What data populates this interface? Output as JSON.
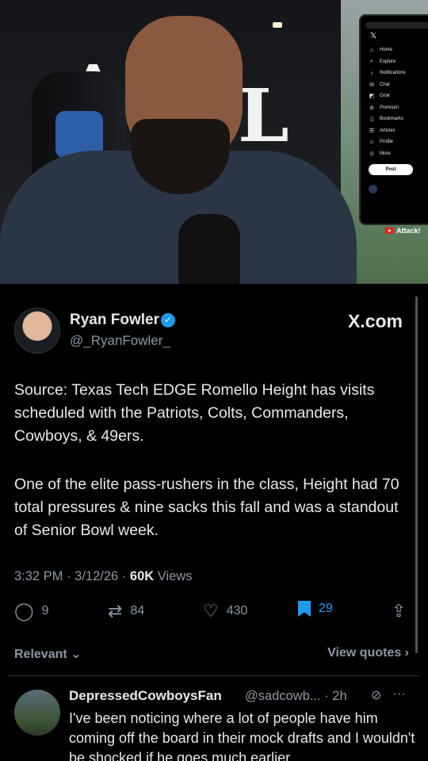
{
  "video": {
    "wall_text_1": "AL",
    "wall_text_2": "L",
    "overlay_tag": "Attack!",
    "phone_menu": [
      "Home",
      "Explore",
      "Notifications",
      "Chat",
      "Grok",
      "Premium",
      "Bookmarks",
      "Articles",
      "Profile",
      "More"
    ],
    "phone_post_label": "Post"
  },
  "tweet": {
    "author_name": "Ryan Fowler",
    "author_handle": "@_RyanFowler_",
    "source_label": "X.com",
    "paragraph_1": "Source: Texas Tech EDGE Romello Height has visits scheduled with the Patriots, Colts, Commanders, Cowboys, & 49ers.",
    "paragraph_2": "One of the elite pass-rushers in the class, Height had 70 total pressures & nine sacks this fall and was a standout of Senior Bowl week.",
    "time": "3:32 PM",
    "date": "3/12/26",
    "views_count": "60K",
    "views_label": "Views",
    "reply_count": "9",
    "retweet_count": "84",
    "like_count": "430",
    "bookmark_count": "29",
    "sort_label": "Relevant",
    "view_quotes_label": "View quotes"
  },
  "reply": {
    "name": "DepressedCowboysFan",
    "handle_time": "@sadcowb... · 2h",
    "text": "I've been noticing where a lot of people have him coming off the board in their mock drafts and I wouldn't be shocked if he goes much earlier"
  },
  "colors": {
    "accent": "#1d9bf0",
    "text": "#e7e9ea",
    "muted": "#8b98a5",
    "background": "#000000"
  }
}
